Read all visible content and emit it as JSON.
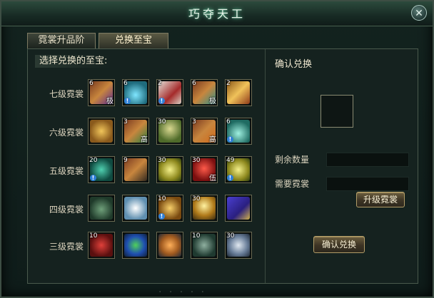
{
  "window": {
    "title": "巧夺天工",
    "close_icon": "close-icon"
  },
  "tabs": [
    {
      "label": "霓裳升品阶",
      "active": false
    },
    {
      "label": "兑换至宝",
      "active": true
    }
  ],
  "left": {
    "heading": "选择兑换的至宝:",
    "rows": [
      {
        "label": "七级霓裳",
        "items": [
          {
            "count": "6",
            "tag": "极",
            "bang": false,
            "icon": "purple-scroll-icon"
          },
          {
            "count": "6",
            "tag": "",
            "bang": true,
            "icon": "cyan-vase-icon"
          },
          {
            "count": "2",
            "tag": "",
            "bang": true,
            "icon": "gift-box-icon"
          },
          {
            "count": "6",
            "tag": "极",
            "bang": false,
            "icon": "teal-scroll-icon"
          },
          {
            "count": "2",
            "tag": "",
            "bang": false,
            "icon": "golden-scroll-icon"
          }
        ]
      },
      {
        "label": "六级霓裳",
        "items": [
          {
            "count": "",
            "tag": "",
            "bang": false,
            "icon": "golden-ore-icon"
          },
          {
            "count": "3",
            "tag": "高",
            "bang": false,
            "icon": "green-scroll-icon"
          },
          {
            "count": "30",
            "tag": "",
            "bang": false,
            "icon": "herb-leaf-icon"
          },
          {
            "count": "3",
            "tag": "高",
            "bang": false,
            "icon": "orange-scroll-icon"
          },
          {
            "count": "6",
            "tag": "",
            "bang": true,
            "icon": "teal-vase-icon"
          }
        ]
      },
      {
        "label": "五级霓裳",
        "items": [
          {
            "count": "20",
            "tag": "",
            "bang": true,
            "icon": "jade-stone-icon"
          },
          {
            "count": "9",
            "tag": "",
            "bang": false,
            "icon": "weapon-scroll-icon"
          },
          {
            "count": "30",
            "tag": "",
            "bang": false,
            "icon": "gold-coin-icon"
          },
          {
            "count": "30",
            "tag": "伍",
            "bang": false,
            "icon": "red-lantern-icon"
          },
          {
            "count": "49",
            "tag": "",
            "bang": true,
            "icon": "gold-coin-icon"
          }
        ]
      },
      {
        "label": "四级霓裳",
        "items": [
          {
            "count": "",
            "tag": "",
            "bang": false,
            "icon": "green-beast-icon"
          },
          {
            "count": "",
            "tag": "",
            "bang": false,
            "icon": "porcelain-vase-icon"
          },
          {
            "count": "10",
            "tag": "",
            "bang": true,
            "icon": "gold-medallion-icon"
          },
          {
            "count": "30",
            "tag": "",
            "bang": false,
            "icon": "crystal-orb-icon"
          },
          {
            "count": "",
            "tag": "",
            "bang": false,
            "icon": "treasure-chest-icon"
          }
        ]
      },
      {
        "label": "三级霓裳",
        "items": [
          {
            "count": "10",
            "tag": "",
            "bang": false,
            "icon": "red-pouch-icon"
          },
          {
            "count": "",
            "tag": "",
            "bang": false,
            "icon": "globe-icon"
          },
          {
            "count": "",
            "tag": "",
            "bang": false,
            "icon": "fire-swirl-icon"
          },
          {
            "count": "10",
            "tag": "",
            "bang": false,
            "icon": "statue-icon"
          },
          {
            "count": "30",
            "tag": "",
            "bang": false,
            "icon": "spirit-orb-icon"
          }
        ]
      }
    ]
  },
  "right": {
    "heading": "确认兑换",
    "remaining_label": "剩余数量",
    "required_label": "需要霓裳",
    "remaining_value": "",
    "required_value": "",
    "upgrade_button": "升级霓裳",
    "confirm_button": "确认兑换"
  },
  "colors": {
    "accent": "#6fd3a8",
    "button_border": "#b29d68",
    "slot_border": "#6a6a52",
    "bang_blue": "#2f7fd7"
  }
}
